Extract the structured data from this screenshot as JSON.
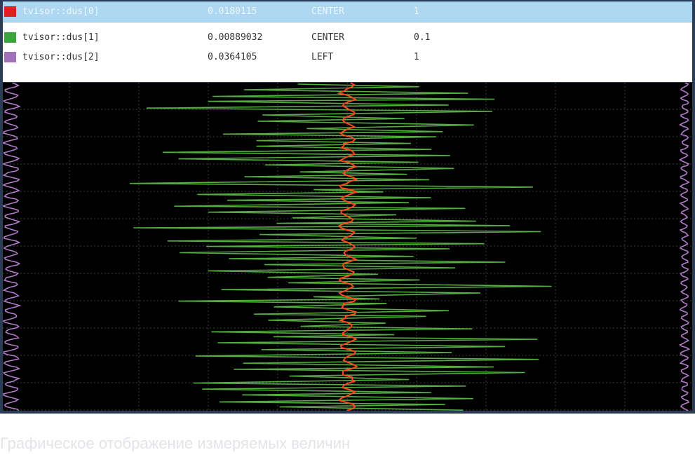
{
  "channels": [
    {
      "name": "tvisor::dus[0]",
      "value": "0.0180115",
      "align": "CENTER",
      "scale": "1",
      "color": "#e02020",
      "selected": true
    },
    {
      "name": "tvisor::dus[1]",
      "value": "0.00889032",
      "align": "CENTER",
      "scale": "0.1",
      "color": "#3aa53a",
      "selected": false
    },
    {
      "name": "tvisor::dus[2]",
      "value": "0.0364105",
      "align": "LEFT",
      "scale": "1",
      "color": "#a070b8",
      "selected": false
    }
  ],
  "trace_colors": {
    "background": "#000000",
    "grid": "#3a3f3a",
    "green": "#5fbf4a",
    "red": "#ff4a1e",
    "purple": "#b27cc8"
  },
  "caption": "Графическое отображение измеряемых величин"
}
